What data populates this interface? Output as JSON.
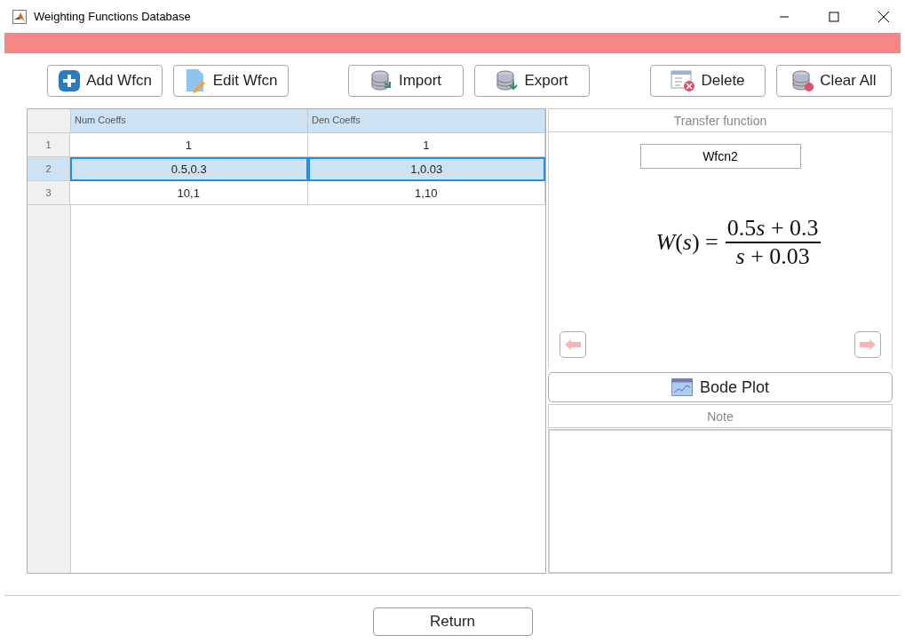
{
  "window": {
    "title": "Weighting Functions Database"
  },
  "toolbar": [
    "Add Wfcn",
    "Edit Wfcn",
    "Import",
    "Export",
    "Delete",
    "Clear All"
  ],
  "table": {
    "columns": [
      "Num Coeffs",
      "Den Coeffs"
    ],
    "rows": [
      {
        "index": "1",
        "cells": [
          "1",
          "1"
        ],
        "selected": false
      },
      {
        "index": "2",
        "cells": [
          "0.5,0.3",
          "1,0.03"
        ],
        "selected": true
      },
      {
        "index": "3",
        "cells": [
          "10,1",
          "1,10"
        ],
        "selected": false
      }
    ]
  },
  "transfer_panel": {
    "title": "Transfer function",
    "name": "Wfcn2",
    "lhs": "*W*(*s*) =",
    "numerator": [
      {
        "kind": "number",
        "text": "0.5"
      },
      {
        "kind": "variable",
        "text": "s"
      },
      {
        "kind": "number",
        "text": " + 0.3"
      }
    ],
    "denominator": [
      {
        "kind": "variable",
        "text": "s"
      },
      {
        "kind": "number",
        "text": " + 0.03"
      }
    ]
  },
  "bode_button": "Bode Plot",
  "note": {
    "title": "Note"
  },
  "footer": {
    "button": "Return"
  }
}
